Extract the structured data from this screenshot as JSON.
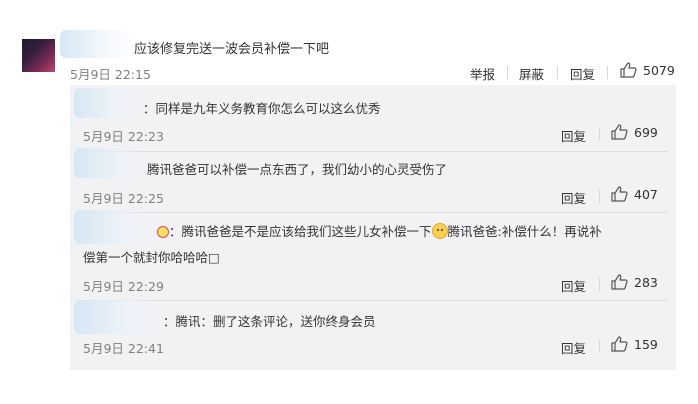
{
  "comment": {
    "text": "应该修复完送一波会员补偿一下吧",
    "time": "5月9日 22:15",
    "actions": {
      "report": "举报",
      "block": "屏蔽",
      "reply": "回复"
    },
    "likes": "5079"
  },
  "replies": [
    {
      "text": "：同样是九年义务教育你怎么可以这么优秀",
      "time": "5月9日 22:23",
      "reply": "回复",
      "likes": "699"
    },
    {
      "text": "腾讯爸爸可以补偿一点东西了，我们幼小的心灵受伤了",
      "time": "5月9日 22:25",
      "reply": "回复",
      "likes": "407"
    },
    {
      "text_a": "：腾讯爸爸是不是应该给我们这些儿女补偿一下",
      "text_b": "腾讯爸爸:补偿什么！再说补",
      "text_c": "偿第一个就封你哈哈哈□",
      "time": "5月9日 22:29",
      "reply": "回复",
      "likes": "283"
    },
    {
      "text": "：腾讯：删了这条评论，送你终身会员",
      "time": "5月9日 22:41",
      "reply": "回复",
      "likes": "159"
    }
  ],
  "icons": {
    "like": "thumbs-up-icon",
    "emoji": "smiley-emoji-icon"
  }
}
